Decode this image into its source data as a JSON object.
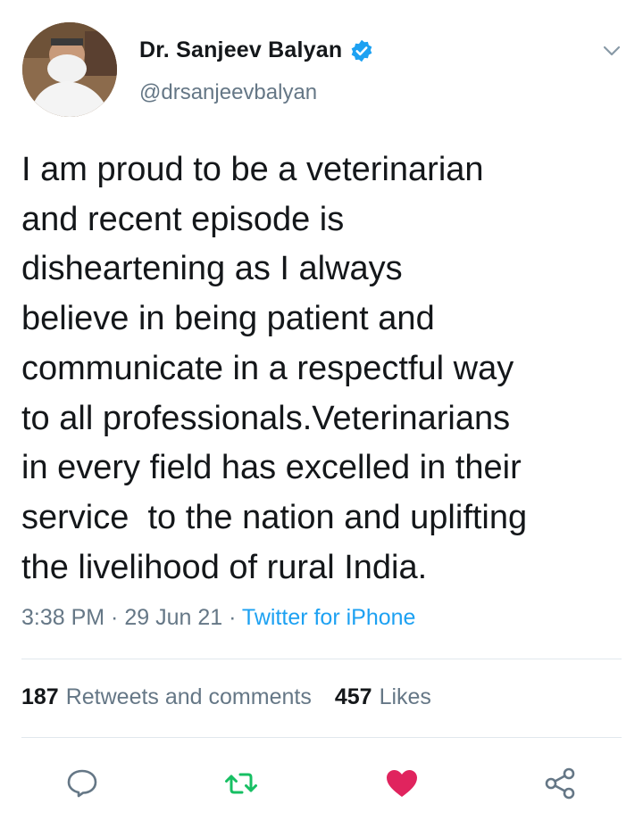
{
  "author": {
    "name": "Dr. Sanjeev Balyan",
    "handle": "@drsanjeevbalyan",
    "verified": true
  },
  "tweet": {
    "lines": [
      "I am proud to be a veterinarian",
      "and recent episode is",
      "disheartening as I always",
      "believe in being patient and",
      "communicate in a respectful way",
      "to all professionals.Veterinarians",
      "in every field has excelled in their",
      "service  to the nation and uplifting",
      "the livelihood of rural India."
    ]
  },
  "meta": {
    "time": "3:38 PM",
    "date": "29 Jun 21",
    "separator": " · ",
    "source": "Twitter for iPhone"
  },
  "stats": {
    "retweets_count": "187",
    "retweets_label": "Retweets and comments",
    "likes_count": "457",
    "likes_label": "Likes"
  },
  "icons": {
    "reply": "reply-icon",
    "retweet": "retweet-icon",
    "like": "heart-icon",
    "share": "share-icon",
    "more": "chevron-down-icon",
    "verified": "verified-badge-icon"
  },
  "colors": {
    "text": "#14171a",
    "secondary": "#657786",
    "link": "#1da1f2",
    "retweet": "#17bf63",
    "like": "#e0245e"
  }
}
